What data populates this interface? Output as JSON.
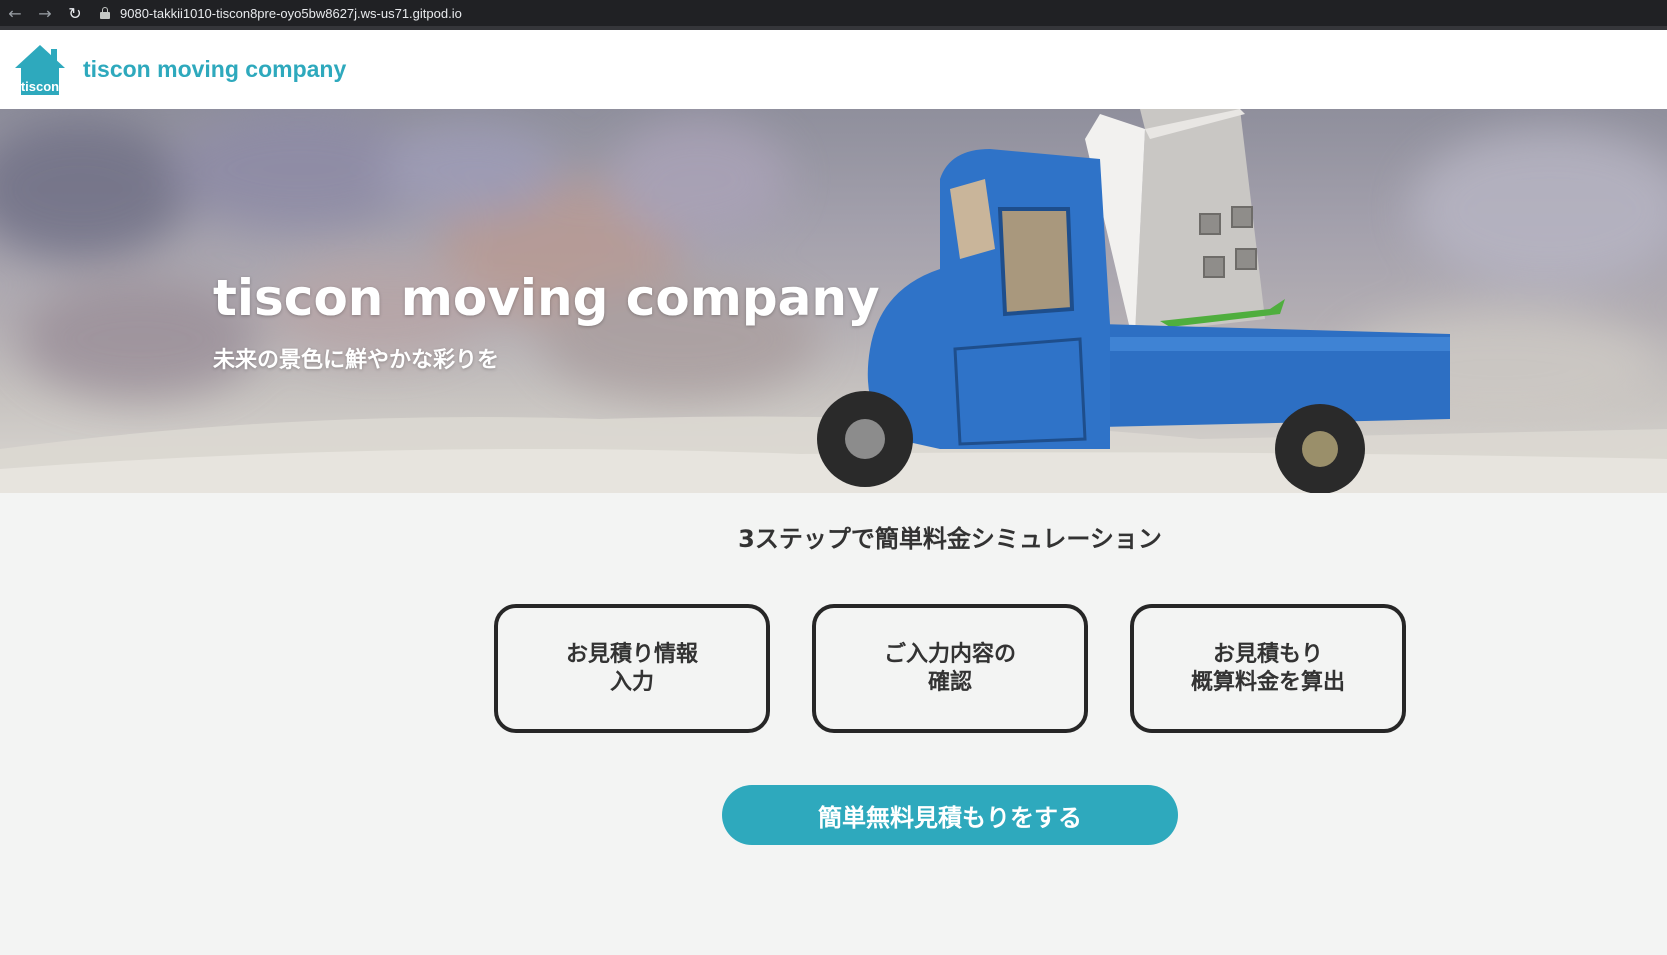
{
  "browser": {
    "url": "9080-takkii1010-tiscon8pre-oyo5bw8627j.ws-us71.gitpod.io",
    "back_glyph": "←",
    "forward_glyph": "→",
    "reload_glyph": "↻"
  },
  "header": {
    "logo_text": "tiscon",
    "brand_name": "tiscon moving company",
    "brand_color": "#2ea9bd"
  },
  "hero": {
    "title": "tiscon moving company",
    "subtitle": "未来の景色に鮮やかな彩りを"
  },
  "main": {
    "section_title": "3ステップで簡単料金シミュレーション",
    "steps": [
      {
        "line1": "お見積り情報",
        "line2": "入力"
      },
      {
        "line1": "ご入力内容の",
        "line2": "確認"
      },
      {
        "line1": "お見積もり",
        "line2": "概算料金を算出"
      }
    ],
    "cta_label": "簡単無料見積もりをする"
  },
  "colors": {
    "accent": "#2ea9bd",
    "page_background": "#f3f4f3",
    "step_border": "#262626"
  }
}
